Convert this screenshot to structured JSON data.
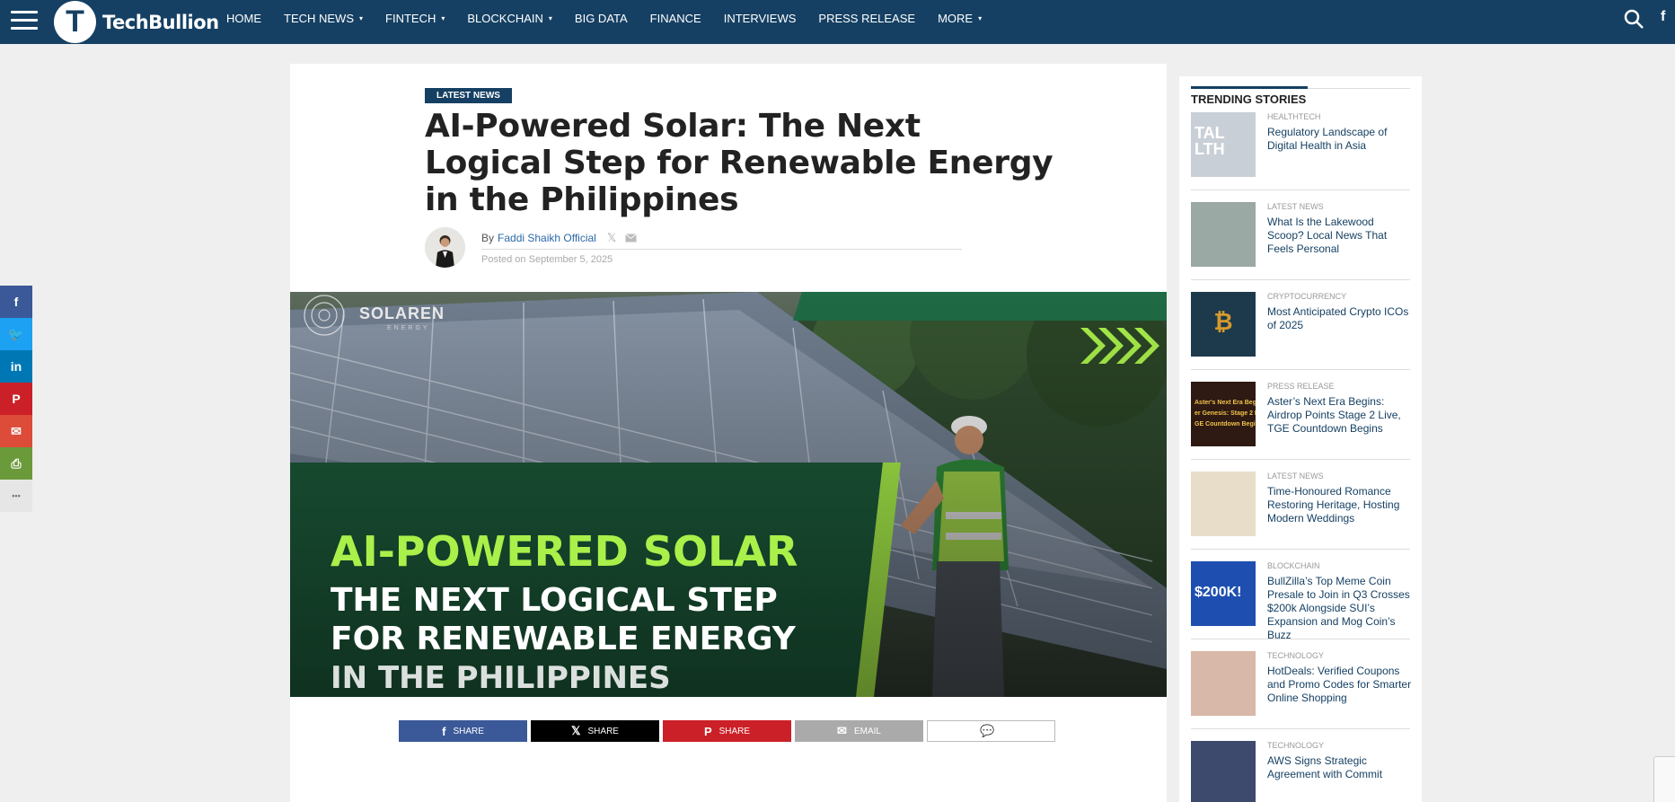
{
  "brand": {
    "logo_letter": "T",
    "name": "TechBullion"
  },
  "nav": {
    "items": [
      {
        "label": "HOME",
        "dropdown": false
      },
      {
        "label": "TECH NEWS",
        "dropdown": true
      },
      {
        "label": "FINTECH",
        "dropdown": true
      },
      {
        "label": "BLOCKCHAIN",
        "dropdown": true
      },
      {
        "label": "BIG DATA",
        "dropdown": false
      },
      {
        "label": "FINANCE",
        "dropdown": false
      },
      {
        "label": "INTERVIEWS",
        "dropdown": false
      },
      {
        "label": "PRESS RELEASE",
        "dropdown": false
      },
      {
        "label": "MORE",
        "dropdown": true
      }
    ],
    "caret": "▾",
    "facebook": "f"
  },
  "rail": {
    "buttons": [
      {
        "icon": "facebook-icon",
        "glyph": "f",
        "color": "#3b5998"
      },
      {
        "icon": "twitter-icon",
        "glyph": "🐦",
        "color": "#1da1f2"
      },
      {
        "icon": "linkedin-icon",
        "glyph": "in",
        "color": "#0077b5"
      },
      {
        "icon": "pinterest-icon",
        "glyph": "P",
        "color": "#cb2027"
      },
      {
        "icon": "email-icon",
        "glyph": "✉",
        "color": "#dd4b39"
      },
      {
        "icon": "print-icon",
        "glyph": "⎙",
        "color": "#6a9a3a"
      },
      {
        "icon": "more-icon",
        "glyph": "•••",
        "color": "#e6e6e6"
      }
    ]
  },
  "article": {
    "category": "LATEST NEWS",
    "title": "AI-Powered Solar: The Next Logical Step for Renewable Energy in the Philippines",
    "by": "By",
    "author": "Faddi Shaikh Official",
    "x_glyph": "𝕏",
    "posted_prefix": "Posted on",
    "date": "September 5, 2025",
    "hero": {
      "brand": "SOLAREN",
      "brand_sub": "ENERGY",
      "line1": "AI-POWERED SOLAR",
      "line2": "THE  NEXT  LOGICAL  STEP",
      "line3": "FOR RENEWABLE ENERGY",
      "line4": "IN THE PHILIPPINES"
    },
    "share": [
      {
        "label": "SHARE",
        "icon": "facebook-icon",
        "glyph": "f",
        "color": "#3b5998"
      },
      {
        "label": "SHARE",
        "icon": "x-icon",
        "glyph": "𝕏",
        "color": "#000000"
      },
      {
        "label": "SHARE",
        "icon": "pinterest-icon",
        "glyph": "P",
        "color": "#cb2027"
      },
      {
        "label": "EMAIL",
        "icon": "email-icon",
        "glyph": "✉",
        "color": "#aaaaaa"
      },
      {
        "label": "",
        "icon": "comment-icon",
        "glyph": "💬",
        "color": "#ffffff"
      }
    ]
  },
  "sidebar": {
    "title": "TRENDING STORIES",
    "stories": [
      {
        "category": "HEALTHTECH",
        "title": "Regulatory Landscape of Digital Health in Asia",
        "thumb_color": "#c9cfd6",
        "thumb_text": "TAL\nLTH"
      },
      {
        "category": "LATEST NEWS",
        "title": "What Is the Lakewood Scoop? Local News That Feels Personal",
        "thumb_color": "#9aa9a3",
        "thumb_text": ""
      },
      {
        "category": "CRYPTOCURRENCY",
        "title": "Most Anticipated Crypto ICOs of 2025",
        "thumb_color": "#1d3a4d",
        "thumb_text": "₿"
      },
      {
        "category": "PRESS RELEASE",
        "title": "Aster’s Next Era Begins: Airdrop Points Stage 2 Live, TGE Countdown Begins",
        "thumb_color": "#2e1a12",
        "thumb_text": "Aster's Next Era Begins\ner Genesis: Stage 2 Li\nGE Countdown Begin"
      },
      {
        "category": "LATEST NEWS",
        "title": "Time-Honoured Romance Restoring Heritage, Hosting Modern Weddings",
        "thumb_color": "#e8ddc9",
        "thumb_text": ""
      },
      {
        "category": "BLOCKCHAIN",
        "title": "BullZilla’s Top Meme Coin Presale to Join in Q3 Crosses $200k Alongside SUI’s Expansion and Mog Coin’s Buzz",
        "thumb_color": "#f0a021",
        "thumb_text": "$200K!"
      },
      {
        "category": "TECHNOLOGY",
        "title": "HotDeals: Verified Coupons and Promo Codes for Smarter Online Shopping",
        "thumb_color": "#d8b8a8",
        "thumb_text": ""
      },
      {
        "category": "TECHNOLOGY",
        "title": "AWS Signs Strategic Agreement with Commit",
        "thumb_color": "#3d4a6e",
        "thumb_text": ""
      }
    ]
  }
}
